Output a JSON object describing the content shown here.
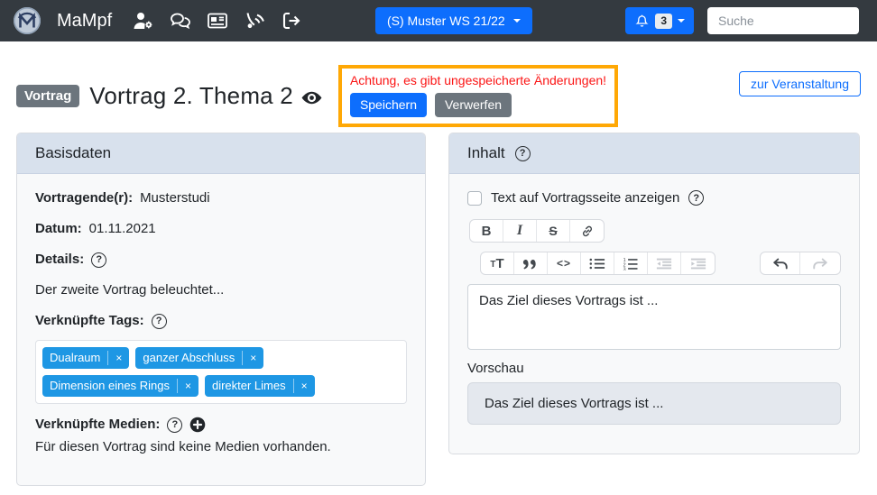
{
  "navbar": {
    "brand": "MaMpf",
    "semester_label": "(S) Muster WS 21/22",
    "notifications_count": "3",
    "search_placeholder": "Suche"
  },
  "page_header": {
    "type_badge": "Vortrag",
    "title": "Vortrag 2. Thema 2",
    "unsaved_warning": "Achtung, es gibt ungespeicherte Änderungen!",
    "save_button": "Speichern",
    "discard_button": "Verwerfen",
    "to_event_button": "zur Veranstaltung"
  },
  "basisdaten": {
    "title": "Basisdaten",
    "speaker_label": "Vortragende(r):",
    "speaker": "Musterstudi",
    "date_label": "Datum:",
    "date": "01.11.2021",
    "details_label": "Details:",
    "details": "Der zweite Vortrag beleuchtet...",
    "tags_label": "Verknüpfte Tags:",
    "tags": [
      "Dualraum",
      "ganzer Abschluss",
      "Dimension eines Rings",
      "direkter Limes"
    ],
    "media_label": "Verknüpfte Medien:",
    "media_empty": "Für diesen Vortrag sind keine Medien vorhanden."
  },
  "inhalt": {
    "title": "Inhalt",
    "show_text_checkbox": "Text auf Vortragsseite anzeigen",
    "editor_text": "Das Ziel dieses Vortrags ist ...",
    "preview_label": "Vorschau",
    "preview_text": "Das Ziel dieses Vortrags ist ..."
  },
  "icons": {
    "navbar": [
      "mampf-logo",
      "user-admin-icon",
      "chats-icon",
      "newspaper-icon",
      "blog-icon",
      "logout-icon",
      "bell-icon",
      "caret-down-icon"
    ],
    "title_row": [
      "eye-icon"
    ],
    "basisdaten": [
      "question-circle-icon",
      "plus-circle-icon",
      "tag-remove-icon"
    ],
    "editor_row1": [
      "bold-icon",
      "italic-icon",
      "strikethrough-icon",
      "link-icon"
    ],
    "editor_row2": [
      "font-size-icon",
      "quote-icon",
      "code-icon",
      "bullet-list-icon",
      "numbered-list-icon",
      "outdent-icon",
      "indent-icon",
      "undo-icon",
      "redo-icon"
    ]
  },
  "colors": {
    "primary_blue": "#0d6efd",
    "secondary_gray": "#6c757d",
    "tag_blue": "#1e97e4",
    "warning_border_orange": "#ffa805",
    "warning_text_red": "#fb1414",
    "navbar_dark": "#343a40",
    "card_header_blue": "#d8e1ed",
    "card_body_bg": "#f8f9fa"
  }
}
